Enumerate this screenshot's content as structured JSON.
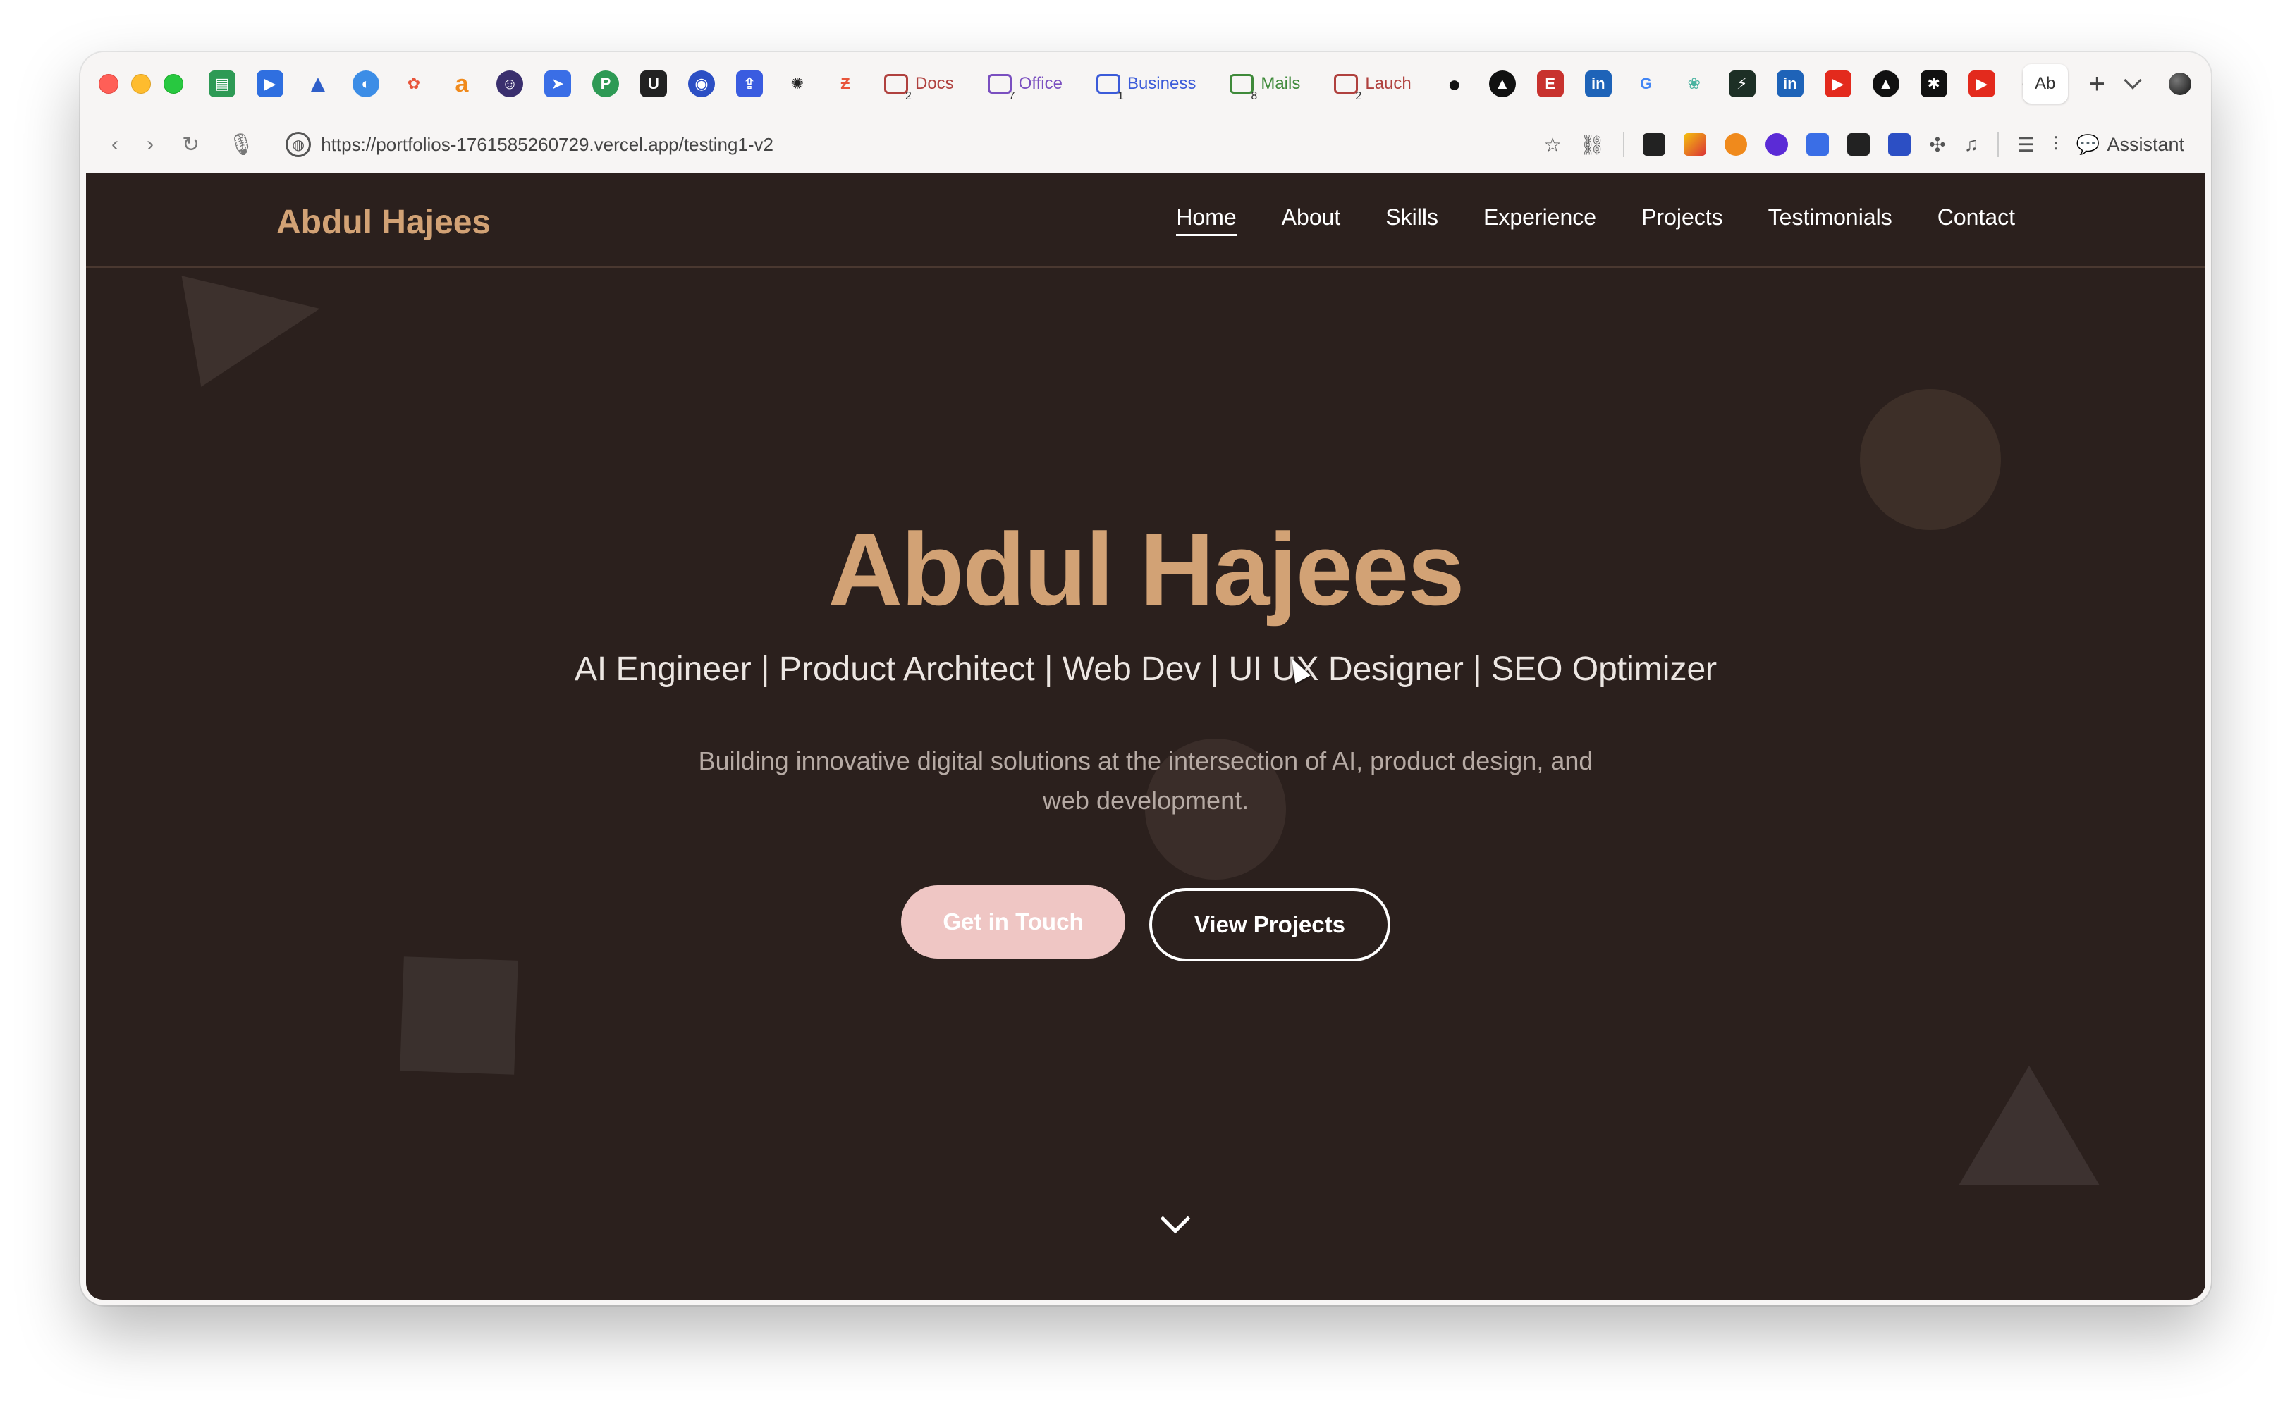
{
  "browser": {
    "tabs": {
      "folders": [
        {
          "label": "Docs",
          "count": "2",
          "color": "#b0413e"
        },
        {
          "label": "Office",
          "count": "7",
          "color": "#7a4fc0"
        },
        {
          "label": "Business",
          "count": "1",
          "color": "#3b5bd9"
        },
        {
          "label": "Mails",
          "count": "8",
          "color": "#3f8a3a"
        },
        {
          "label": "Lauch",
          "count": "2",
          "color": "#b0413e"
        }
      ],
      "active_tab_label": "Ab",
      "new_tab": "+"
    },
    "address": {
      "url": "https://portfolios-1761585260729.vercel.app/testing1-v2",
      "assistant_label": "Assistant"
    }
  },
  "site": {
    "brand": "Abdul Hajees",
    "nav": [
      {
        "label": "Home",
        "active": true
      },
      {
        "label": "About"
      },
      {
        "label": "Skills"
      },
      {
        "label": "Experience"
      },
      {
        "label": "Projects"
      },
      {
        "label": "Testimonials"
      },
      {
        "label": "Contact"
      }
    ],
    "hero": {
      "title": "Abdul Hajees",
      "subtitle": "AI Engineer | Product Architect | Web Dev | UI UX Designer | SEO Optimizer",
      "description": "Building innovative digital solutions at the intersection of AI, product design, and web development.",
      "primary_button": "Get in Touch",
      "secondary_button": "View Projects"
    },
    "colors": {
      "background": "#2b201d",
      "accent": "#d2a275",
      "primary_button": "#efc6c4"
    }
  }
}
